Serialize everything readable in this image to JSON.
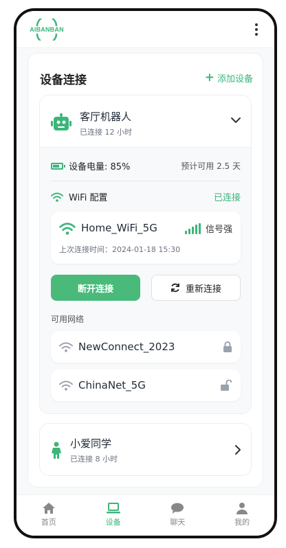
{
  "header": {
    "logo_text": "AIBANBAN"
  },
  "section": {
    "title": "设备连接",
    "add_label": "添加设备"
  },
  "device1": {
    "name": "客厅机器人",
    "status": "已连接 12 小时",
    "battery_label": "设备电量: 85%",
    "battery_level": 0.85,
    "remaining": "预计可用 2.5 天",
    "wifi_label": "WiFi 配置",
    "wifi_status": "已连接",
    "current_network": {
      "ssid": "Home_WiFi_5G",
      "signal": "信号强",
      "last_connected": "上次连接时间：2024-01-18 15:30"
    },
    "disconnect_label": "断开连接",
    "reconnect_label": "重新连接",
    "available_label": "可用网络",
    "available_networks": [
      {
        "ssid": "NewConnect_2023",
        "lock": "locked"
      },
      {
        "ssid": "ChinaNet_5G",
        "lock": "unlocked"
      }
    ]
  },
  "device2": {
    "name": "小爱同学",
    "status": "已连接 8 小时"
  },
  "nav": [
    {
      "label": "首页",
      "icon": "home-icon"
    },
    {
      "label": "设备",
      "icon": "laptop-icon"
    },
    {
      "label": "聊天",
      "icon": "chat-icon"
    },
    {
      "label": "我的",
      "icon": "user-icon"
    }
  ],
  "colors": {
    "accent": "#3bb57a",
    "button": "#4aba7b",
    "text": "#1f2937",
    "muted": "#6b7280"
  }
}
